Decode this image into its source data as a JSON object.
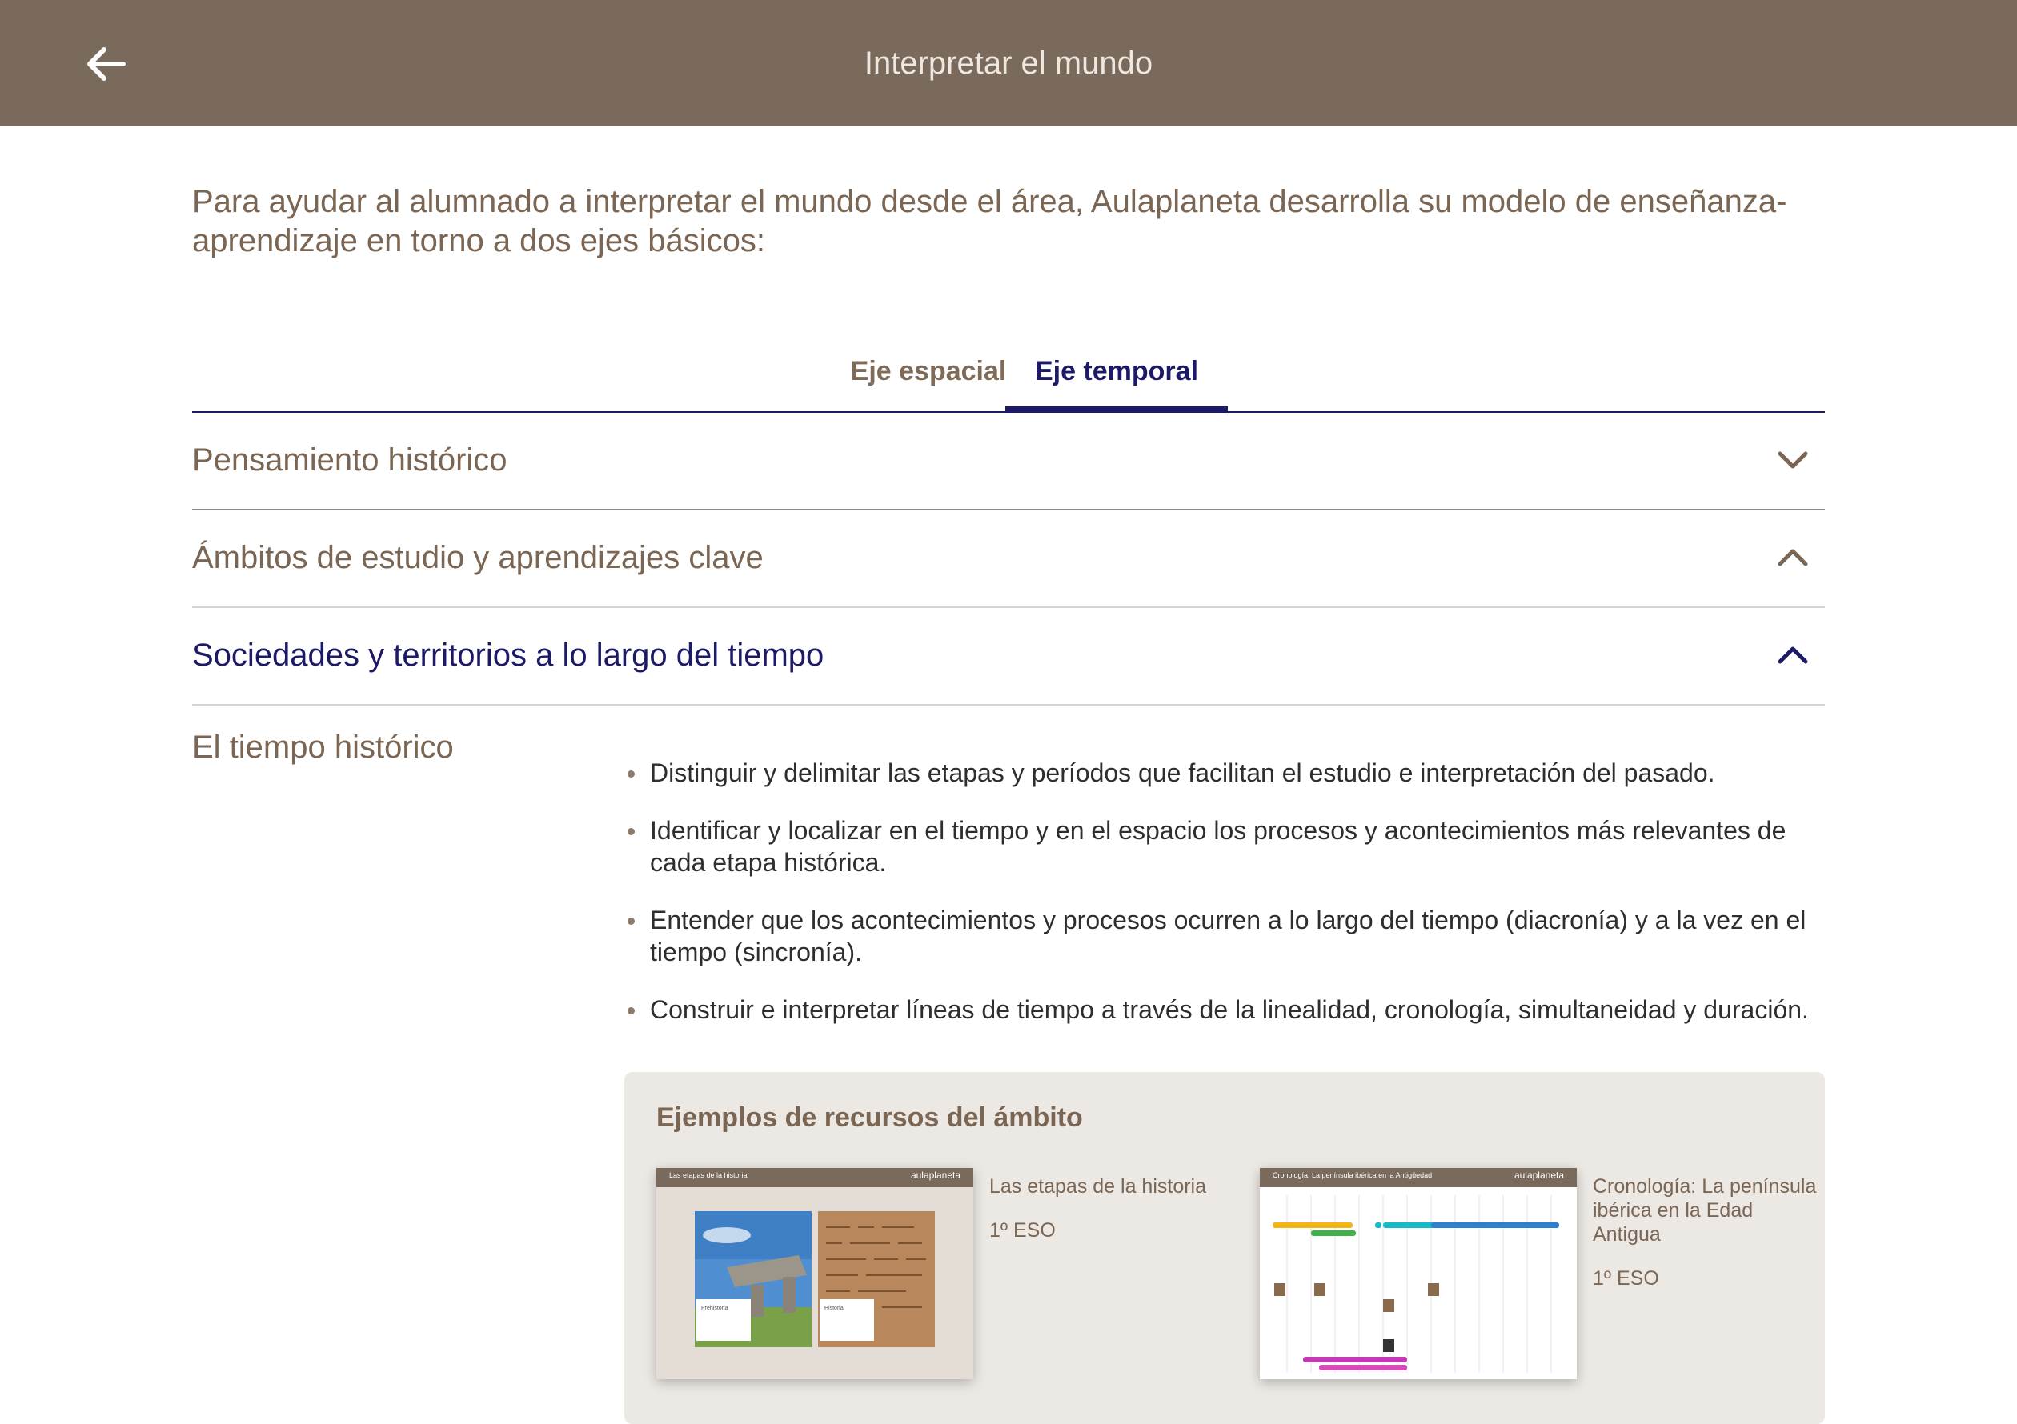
{
  "header": {
    "title": "Interpretar el mundo",
    "back_icon": "arrow-left-icon"
  },
  "intro": {
    "text": "Para ayudar al alumnado a interpretar el mundo desde el área, Aulaplaneta desarrolla su modelo de enseñanza-aprendizaje en torno a dos ejes básicos:"
  },
  "tabs": [
    {
      "label": "Eje espacial",
      "active": false
    },
    {
      "label": "Eje temporal",
      "active": true
    }
  ],
  "accordion": [
    {
      "label": "Pensamiento histórico",
      "icon": "chevron-down-icon"
    },
    {
      "label": "Ámbitos de estudio y aprendizajes clave",
      "icon": "chevron-up-icon"
    },
    {
      "label": "Sociedades y territorios a lo largo del tiempo",
      "icon": "chevron-up-icon"
    }
  ],
  "section": {
    "title": "El tiempo histórico",
    "bullets": [
      "Distinguir y delimitar las etapas y períodos que facilitan el estudio e interpretación del pasado.",
      "Identificar y localizar en el tiempo y en el espacio los procesos y acontecimientos más relevantes de cada etapa histórica.",
      "Entender que los acontecimientos y procesos ocurren a lo largo del tiempo (diacronía) y a la vez en el tiempo (sincronía).",
      "Construir e interpretar líneas de tiempo a través de la linealidad, cronología, simultaneidad y duración."
    ]
  },
  "resources": {
    "title": "Ejemplos de recursos del ámbito",
    "items": [
      {
        "name": "Las etapas de la historia",
        "level": "1º ESO",
        "thumb_title": "Las etapas de la historia",
        "thumb_logo": "aulaplaneta",
        "panels": [
          "Prehistoria",
          "Historia"
        ]
      },
      {
        "name": "Cronología: La península ibérica en la Edad Antigua",
        "level": "1º ESO",
        "thumb_title": "Cronología: La península ibérica en la Antigüedad",
        "thumb_logo": "aulaplaneta"
      }
    ]
  },
  "colors": {
    "header_bg": "#7a6a5b",
    "brown_text": "#7a6653",
    "accent_navy": "#1c1a66",
    "panel_bg": "#ece8e4"
  }
}
